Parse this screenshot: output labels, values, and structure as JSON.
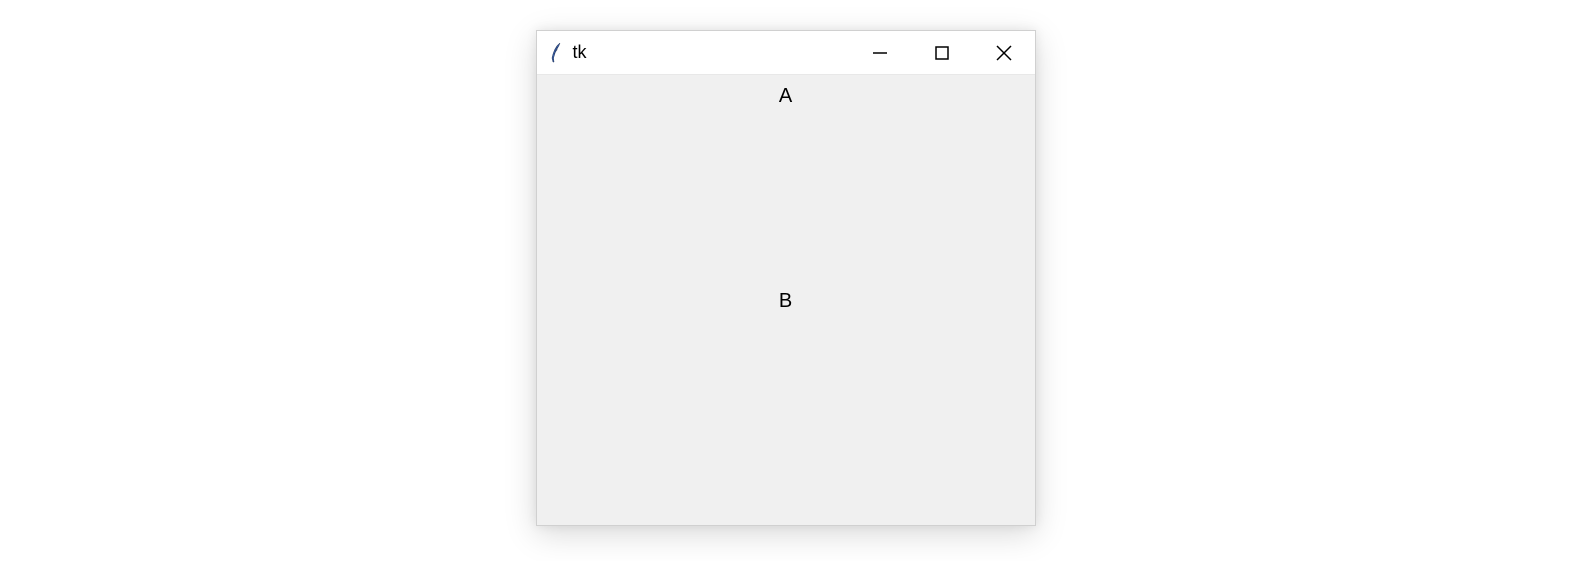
{
  "window": {
    "title": "tk",
    "labels": {
      "a": "A",
      "b": "B"
    }
  }
}
